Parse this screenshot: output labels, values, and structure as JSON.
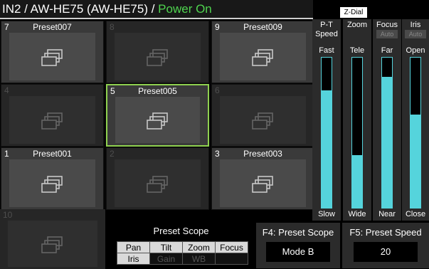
{
  "header": {
    "device": "IN2 / AW-HE75 (AW-HE75) / ",
    "status": "Power On",
    "colors": {
      "status": "#4fd44f"
    }
  },
  "presets": [
    {
      "num": "7",
      "name": "Preset007",
      "filled": true
    },
    {
      "num": "8",
      "name": "",
      "filled": false
    },
    {
      "num": "9",
      "name": "Preset009",
      "filled": true
    },
    {
      "num": "4",
      "name": "",
      "filled": false
    },
    {
      "num": "5",
      "name": "Preset005",
      "filled": true,
      "selected": true
    },
    {
      "num": "6",
      "name": "",
      "filled": false
    },
    {
      "num": "1",
      "name": "Preset001",
      "filled": true
    },
    {
      "num": "2",
      "name": "",
      "filled": false
    },
    {
      "num": "3",
      "name": "Preset003",
      "filled": true
    },
    {
      "num": "10",
      "name": "",
      "filled": false
    }
  ],
  "scope": {
    "title": "Preset Scope",
    "row1": [
      "Pan",
      "Tilt",
      "Zoom",
      "Focus"
    ],
    "row2": [
      "Iris",
      "Gain",
      "WB",
      ""
    ]
  },
  "f4": {
    "title": "F4: Preset Scope",
    "value": "Mode B"
  },
  "f5": {
    "title": "F5: Preset Speed",
    "value": "20"
  },
  "zdial": "Z-Dial",
  "controls": {
    "pt": {
      "label1": "P-T",
      "label2": "Speed",
      "top": "Fast",
      "bottom": "Slow",
      "level": 0.78
    },
    "zoom": {
      "label1": "Zoom",
      "top": "Tele",
      "bottom": "Wide",
      "level": 0.35
    },
    "focus": {
      "label1": "Focus",
      "auto": "Auto",
      "top": "Far",
      "bottom": "Near",
      "level": 0.87
    },
    "iris": {
      "label1": "Iris",
      "auto": "Auto",
      "top": "Open",
      "bottom": "Close",
      "level": 0.62
    }
  },
  "icon": "preset-stack-icon"
}
